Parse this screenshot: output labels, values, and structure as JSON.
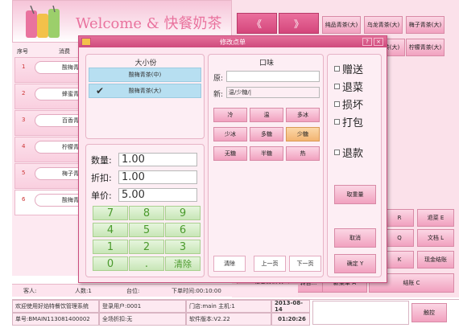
{
  "app": {
    "welcome": "Welcome & 快餐奶茶"
  },
  "left": {
    "col_no": "序号",
    "col_name": "消费",
    "rows": [
      {
        "no": "1",
        "name": "酸梅青"
      },
      {
        "no": "2",
        "name": "蜂蜜青"
      },
      {
        "no": "3",
        "name": "百香青"
      },
      {
        "no": "4",
        "name": "柠檬青"
      },
      {
        "no": "5",
        "name": "梅子青"
      },
      {
        "no": "6",
        "name": "酸梅青"
      }
    ]
  },
  "right": {
    "nav_prev": "《",
    "nav_next": "》",
    "menu_row1": [
      "纯品青茶(大)",
      "乌龙青茶(大)",
      "梅子青茶(大)"
    ],
    "menu_row2": [
      "青茶(大)",
      "柠檬青茶(大)"
    ],
    "btns": {
      "r": "R",
      "q": "Q",
      "k": "K",
      "return_e": "退菜 E",
      "discount_l": "文档 L",
      "cash": "现金结账",
      "checkout_c": "结账 C",
      "cancel_order": "退单取消 D",
      "transfer": "转台...",
      "new_add": "新菜单 A"
    }
  },
  "dialog": {
    "title": "修改点单",
    "size_label": "大小份",
    "sizes": [
      "酸梅青茶(中)",
      "酸梅青茶(大)"
    ],
    "qty_label": "数量:",
    "qty": "1.00",
    "discount_label": "折扣:",
    "discount": "1.00",
    "price_label": "单价:",
    "price": "5.00",
    "keys": [
      "7",
      "8",
      "9",
      "4",
      "5",
      "6",
      "1",
      "2",
      "3",
      "0",
      ".",
      "清除"
    ],
    "taste_label": "口味",
    "orig_label": "原:",
    "orig_value": "",
    "new_label": "新:",
    "new_value": "温/少糖/|",
    "tastes": [
      "冷",
      "温",
      "多冰",
      "少冰",
      "多糖",
      "少糖",
      "无糖",
      "半糖",
      "热"
    ],
    "taste_clear": "清除",
    "prev_page": "上一页",
    "next_page": "下一页",
    "checks": [
      "赠送",
      "退菜",
      "损坏",
      "打包",
      "退款"
    ],
    "reset": "取重量",
    "cancel": "取消",
    "ok": "确定 Y"
  },
  "status": {
    "guest": "客人:",
    "people": "人数:1",
    "seat": "台位:",
    "time": "下单时间:00:10:00"
  },
  "footer": {
    "welcome": "欢迎使用好焰特餐饮管理系统",
    "user": "登录用户:0001",
    "store": "门店:main  主机:1",
    "date": "2013-08-14",
    "order_no": "单号:BMAIN113081400002",
    "full_disc": "全场折扣:无",
    "version": "软件版本:V2.22",
    "time": "01:20:26",
    "touch": "触控"
  }
}
